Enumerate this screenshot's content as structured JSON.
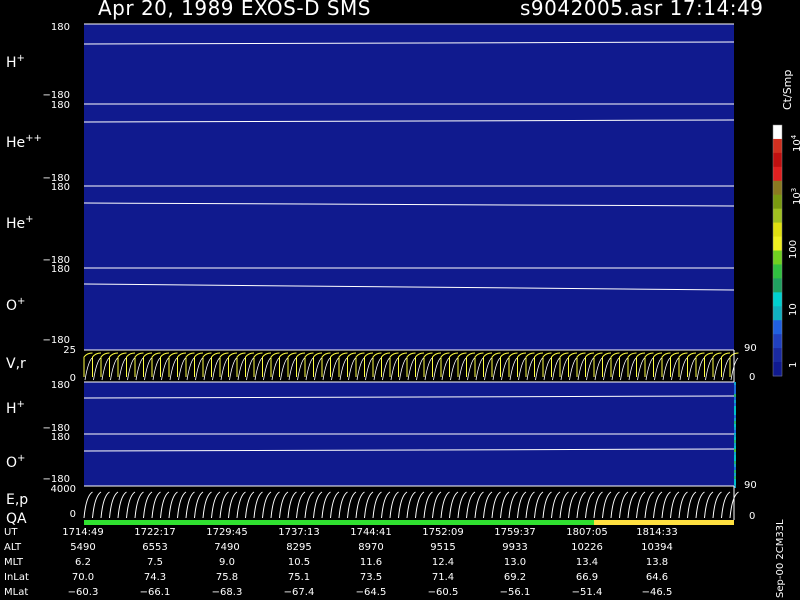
{
  "header": {
    "title_left": "Apr 20, 1989    EXOS-D SMS",
    "title_right": "s9042005.asr  17:14:49"
  },
  "panels": [
    {
      "name": "h-plus-top",
      "label": "H",
      "sup": "+",
      "tick_top": "180",
      "tick_bot": "−180"
    },
    {
      "name": "he-plus-plus",
      "label": "He",
      "sup": "++",
      "tick_top": "180",
      "tick_bot": "−180"
    },
    {
      "name": "he-plus",
      "label": "He",
      "sup": "+",
      "tick_top": "180",
      "tick_bot": "−180"
    },
    {
      "name": "o-plus-top",
      "label": "O",
      "sup": "+",
      "tick_top": "180",
      "tick_bot": "−180"
    },
    {
      "name": "vr",
      "label": "V,r",
      "sup": "",
      "tick_top": "25",
      "tick_bot": "0",
      "rtick_top": "90",
      "rtick_bot": "0"
    },
    {
      "name": "h-plus-bottom",
      "label": "H",
      "sup": "+",
      "tick_top": "180",
      "tick_bot": "−180"
    },
    {
      "name": "o-plus-bottom",
      "label": "O",
      "sup": "+",
      "tick_top": "180",
      "tick_bot": "−180"
    },
    {
      "name": "ep",
      "label": "E,p",
      "sup": "",
      "tick_top": "4000",
      "tick_bot": "0",
      "rtick_top": "90",
      "rtick_bot": "0"
    }
  ],
  "qa_label": "QA",
  "colorbar": {
    "unit": "Ct/Smp",
    "labels": [
      {
        "text": "10",
        "sup": "4"
      },
      {
        "text": "10",
        "sup": "3"
      },
      {
        "text": "100",
        "sup": ""
      },
      {
        "text": "10",
        "sup": ""
      },
      {
        "text": "1",
        "sup": ""
      }
    ],
    "colors": [
      "#ffffff",
      "#d03020",
      "#c01010",
      "#e02020",
      "#8a7a20",
      "#7a9a10",
      "#a0c020",
      "#e0e010",
      "#f0f020",
      "#70d020",
      "#30c040",
      "#20a060",
      "#00d0d0",
      "#10b0c0",
      "#2060e0",
      "#2040c0",
      "#1a2aa0",
      "#101a90"
    ]
  },
  "footer": {
    "rows": [
      {
        "label": "UT",
        "values": [
          "1714:49",
          "1722:17",
          "1729:45",
          "1737:13",
          "1744:41",
          "1752:09",
          "1759:37",
          "1807:05",
          "1814:33"
        ]
      },
      {
        "label": "ALT",
        "values": [
          "5490",
          "6553",
          "7490",
          "8295",
          "8970",
          "9515",
          "9933",
          "10226",
          "10394"
        ]
      },
      {
        "label": "MLT",
        "values": [
          "6.2",
          "7.5",
          "9.0",
          "10.5",
          "11.6",
          "12.4",
          "13.0",
          "13.4",
          "13.8"
        ]
      },
      {
        "label": "InLat",
        "values": [
          "70.0",
          "74.3",
          "75.8",
          "75.1",
          "73.5",
          "71.4",
          "69.2",
          "66.9",
          "64.6"
        ]
      },
      {
        "label": "MLat",
        "values": [
          "−60.3",
          "−66.1",
          "−68.3",
          "−67.4",
          "−64.5",
          "−60.5",
          "−56.1",
          "−51.4",
          "−46.5"
        ]
      }
    ],
    "version": "Sep-00 2CM33L"
  }
}
